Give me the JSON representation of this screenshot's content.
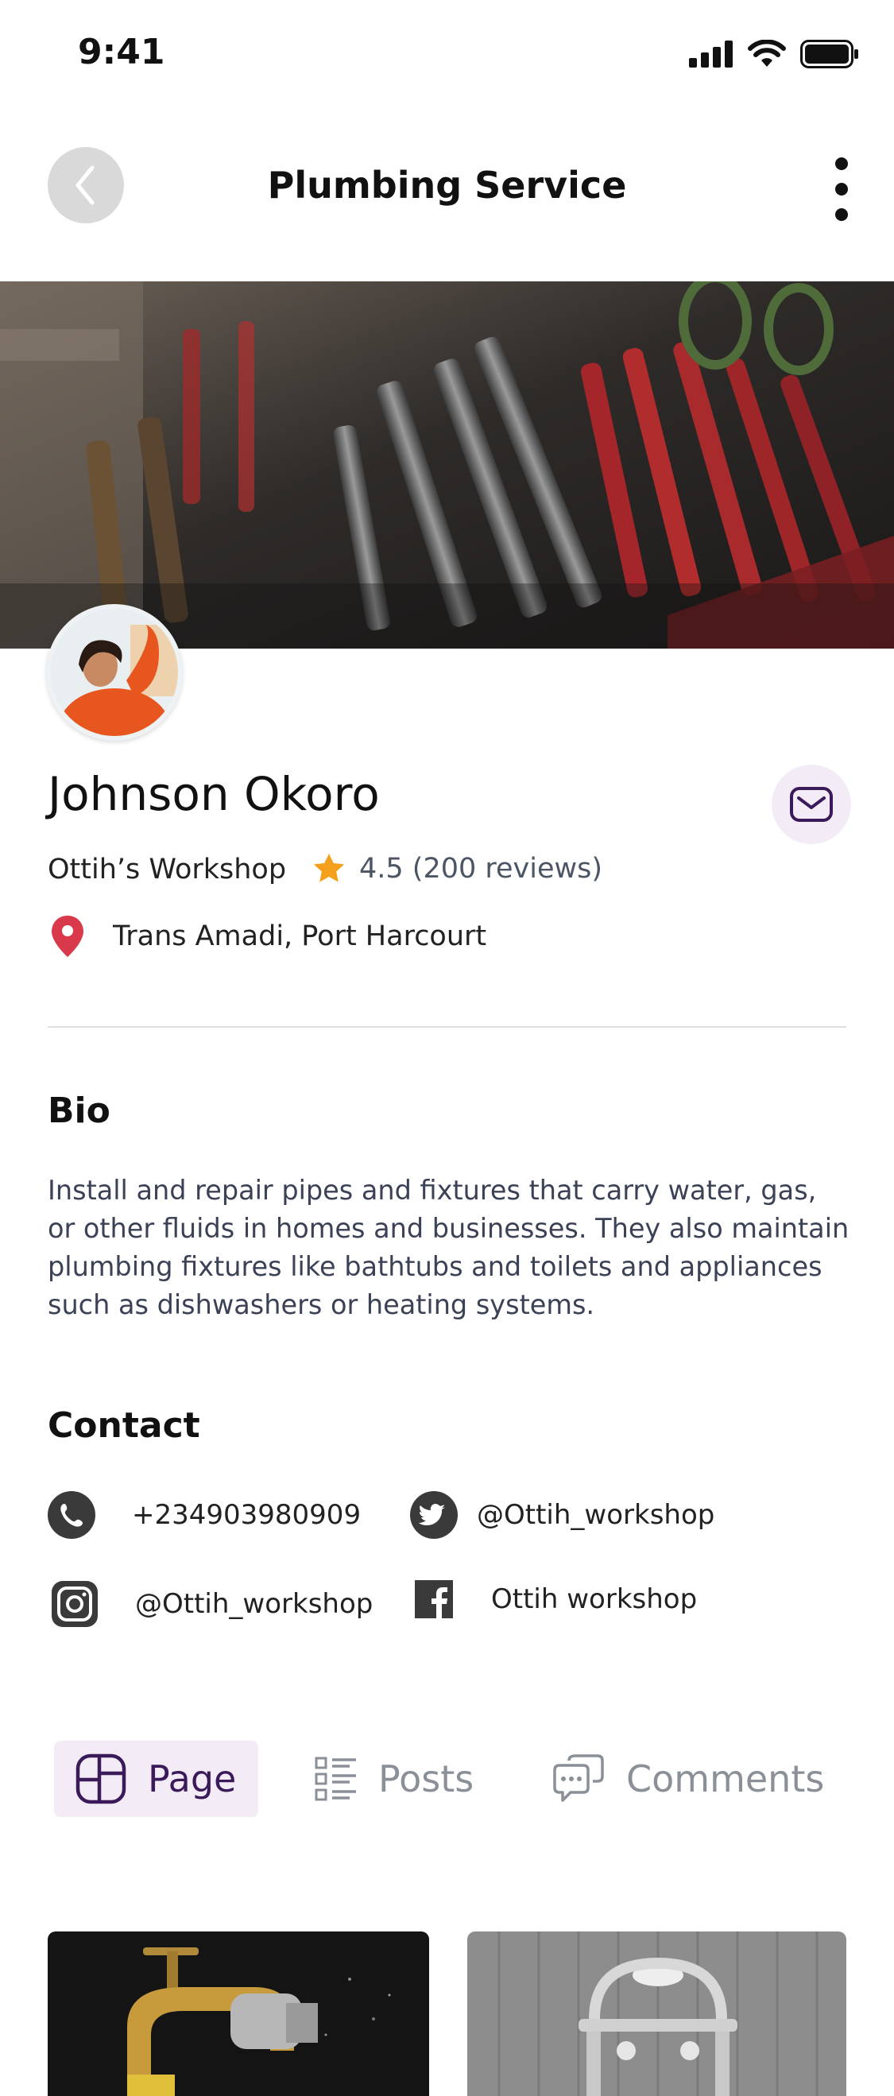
{
  "status_bar": {
    "time": "9:41"
  },
  "header": {
    "title": "Plumbing Service"
  },
  "profile": {
    "name": "Johnson Okoro",
    "workshop": "Ottih’s Workshop",
    "rating": "4.5 (200 reviews)",
    "location": "Trans Amadi, Port Harcourt"
  },
  "bio": {
    "title": "Bio",
    "text": "Install and repair pipes and fixtures that carry water, gas, or other fluids in homes and businesses. They also maintain plumbing fixtures like bathtubs and toilets and appliances such as dishwashers or heating systems."
  },
  "contact": {
    "title": "Contact",
    "phone": "+234903980909",
    "twitter": "@Ottih_workshop",
    "instagram": "@Ottih_workshop",
    "facebook": "Ottih workshop"
  },
  "tabs": [
    {
      "label": "Page",
      "icon": "page-layout-icon",
      "active": true
    },
    {
      "label": "Posts",
      "icon": "list-icon",
      "active": false
    },
    {
      "label": "Comments",
      "icon": "chat-bubbles-icon",
      "active": false
    }
  ],
  "colors": {
    "accent_purple": "#3b1a5a",
    "tab_active_bg": "#f3ecf7",
    "star": "#f4a01c",
    "location_pin": "#d93a4b"
  }
}
